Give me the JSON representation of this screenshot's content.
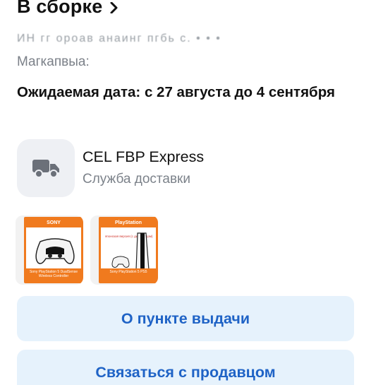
{
  "header": {
    "title": "В сборке"
  },
  "address": {
    "line": "ИН гг ороав анаинг пгбь с. • • •",
    "city": "Магкапвыа:"
  },
  "delivery": {
    "expected": "Ожидаемая дата: с 27 августа до 4 сентября"
  },
  "carrier": {
    "name": "CEL FBP Express",
    "subtitle": "Служба доставки",
    "icon": "truck-icon"
  },
  "products": [
    {
      "brand": "SONY",
      "caption": "Sony PlayStation 5 DualSense Wireless Controller"
    },
    {
      "brand": "PlayStation",
      "note": "японская версия (с дисководом)",
      "caption": "Sony PlayStation 5 PS5"
    }
  ],
  "actions": {
    "pickup": "О пункте выдачи",
    "contact": "Связаться с продавцом"
  },
  "colors": {
    "accent": "#1f63c6",
    "button_bg": "#e6f2fc",
    "tile_bg": "#eef0f4",
    "box_orange": "#f07a1e"
  }
}
